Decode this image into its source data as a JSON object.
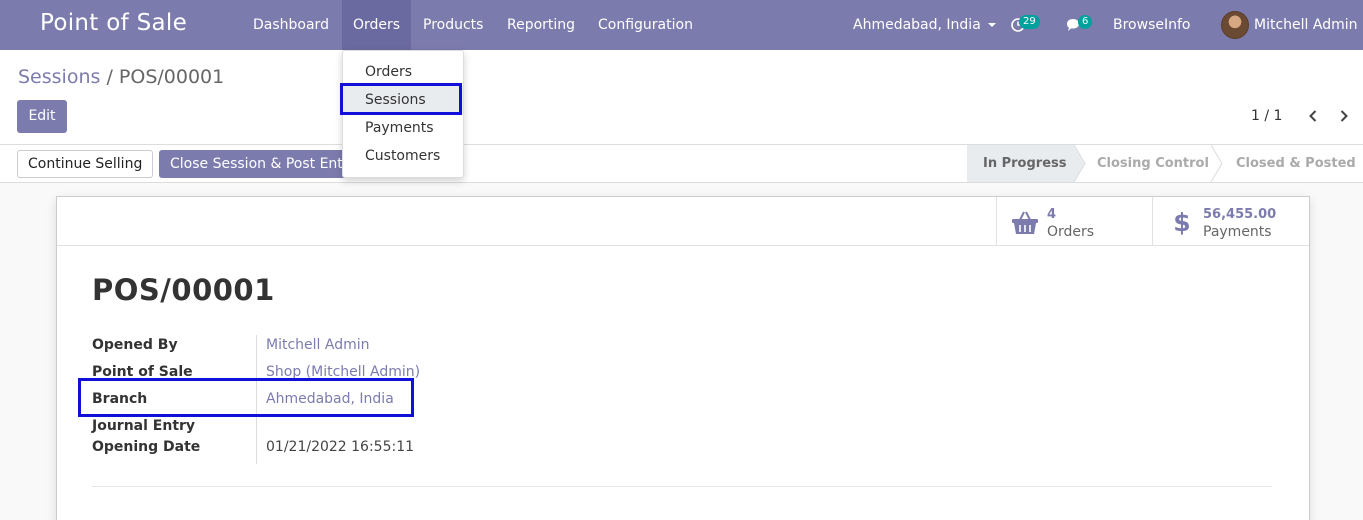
{
  "navbar": {
    "brand": "Point of Sale",
    "menu": [
      "Dashboard",
      "Orders",
      "Products",
      "Reporting",
      "Configuration"
    ],
    "branch": "Ahmedabad, India",
    "activity_count": "29",
    "messages_count": "6",
    "company": "BrowseInfo",
    "user": "Mitchell Admin"
  },
  "dropdown": {
    "items": [
      "Orders",
      "Sessions",
      "Payments",
      "Customers"
    ],
    "selected": "Sessions"
  },
  "breadcrumb": {
    "parent": "Sessions",
    "separator": "/",
    "current": "POS/00001"
  },
  "control": {
    "edit_label": "Edit",
    "pager": "1 / 1"
  },
  "statusbar": {
    "continue_label": "Continue Selling",
    "close_label": "Close Session & Post Entries",
    "stages": [
      "In Progress",
      "Closing Control",
      "Closed & Posted"
    ],
    "current_stage": "In Progress"
  },
  "stats": {
    "orders_value": "4",
    "orders_label": "Orders",
    "payments_value": "56,455.00",
    "payments_label": "Payments"
  },
  "form": {
    "title": "POS/00001",
    "fields": [
      {
        "label": "Opened By",
        "value": "Mitchell Admin"
      },
      {
        "label": "Point of Sale",
        "value": "Shop (Mitchell Admin)"
      },
      {
        "label": "Branch",
        "value": "Ahmedabad, India"
      },
      {
        "label": "Journal Entry",
        "value": ""
      },
      {
        "label": "Opening Date",
        "value": "01/21/2022 16:55:11"
      }
    ]
  },
  "colors": {
    "brand": "#7c7bad",
    "highlight": "#1010d8",
    "badge": "#00a09d"
  }
}
